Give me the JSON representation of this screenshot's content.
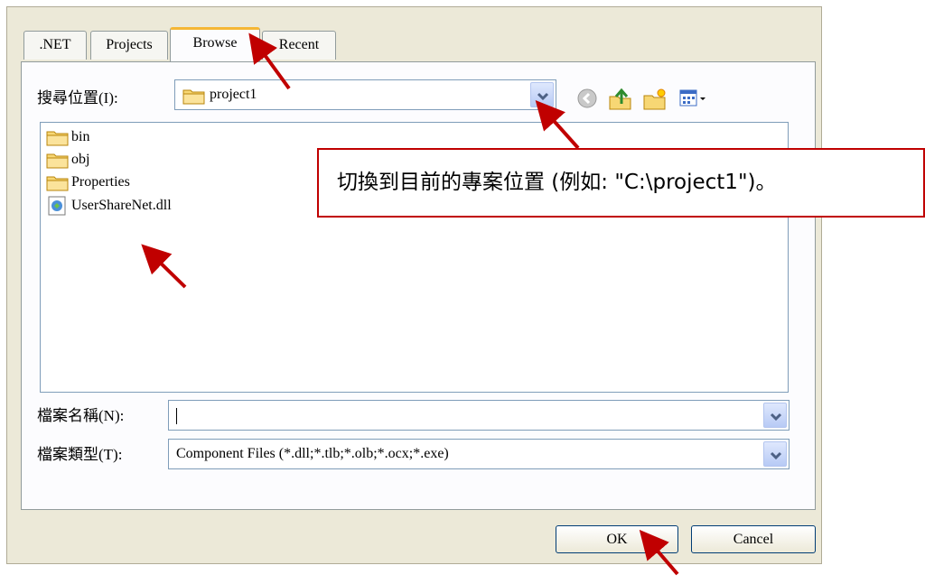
{
  "tabs": [
    {
      "label": ".NET"
    },
    {
      "label": "Projects"
    },
    {
      "label": "Browse"
    },
    {
      "label": "Recent"
    }
  ],
  "look_in": {
    "label": "搜尋位置(I):",
    "value": "project1"
  },
  "toolbar_icons": [
    "back-icon",
    "up-folder-icon",
    "new-folder-icon",
    "views-menu-icon"
  ],
  "files": [
    {
      "name": "bin",
      "icon": "folder-icon"
    },
    {
      "name": "obj",
      "icon": "folder-icon"
    },
    {
      "name": "Properties",
      "icon": "folder-icon"
    },
    {
      "name": "UserShareNet.dll",
      "icon": "dll-file-icon"
    }
  ],
  "file_name": {
    "label": "檔案名稱(N):",
    "value": ""
  },
  "file_type": {
    "label": "檔案類型(T):",
    "value": "Component Files (*.dll;*.tlb;*.olb;*.ocx;*.exe)"
  },
  "buttons": {
    "ok": "OK",
    "cancel": "Cancel"
  },
  "callout": {
    "text": "切換到目前的專案位置 (例如: \"C:\\project1\")。"
  },
  "colors": {
    "dialog_bg": "#ece9d8",
    "active_tab_accent": "#f5b735",
    "annotation_red": "#c00000",
    "combo_border": "#7f9db9"
  }
}
